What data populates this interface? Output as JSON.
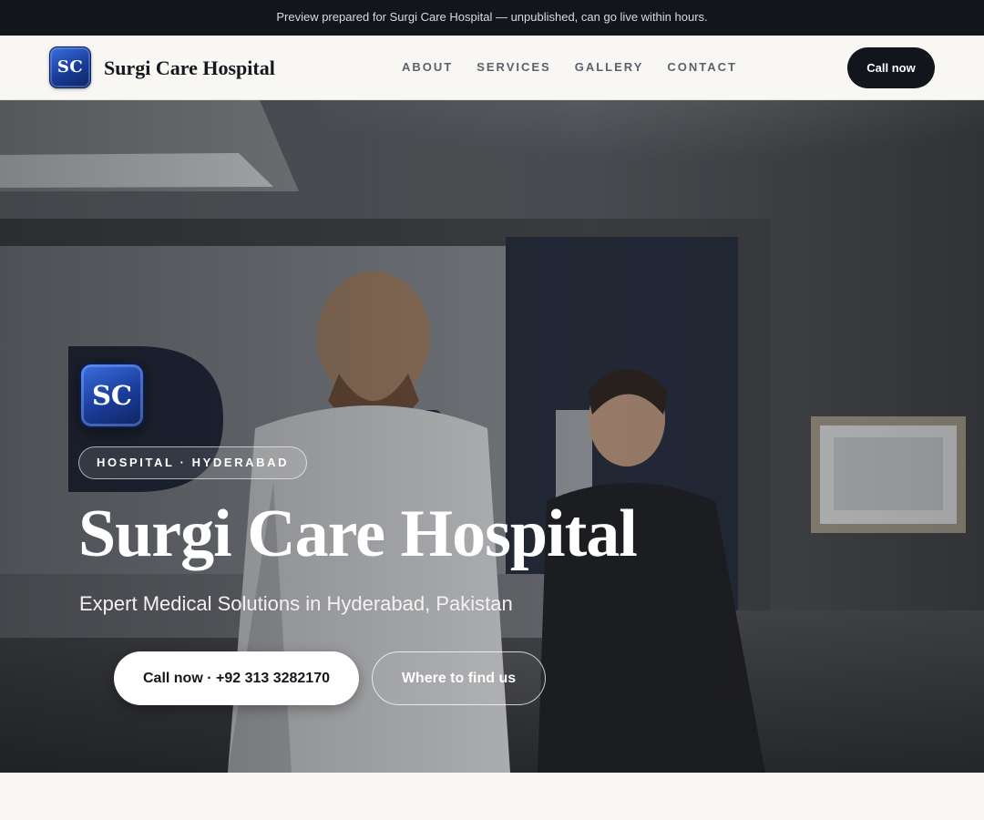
{
  "preview_banner": {
    "text": "Preview prepared for Surgi Care Hospital — unpublished, can go live within hours."
  },
  "header": {
    "logo_initials": "SC",
    "brand_name": "Surgi Care Hospital",
    "nav": [
      {
        "label": "ABOUT"
      },
      {
        "label": "SERVICES"
      },
      {
        "label": "GALLERY"
      },
      {
        "label": "CONTACT"
      }
    ],
    "call_button": "Call now"
  },
  "hero": {
    "logo_initials": "SC",
    "badge": "HOSPITAL · HYDERABAD",
    "title": "Surgi Care Hospital",
    "subtitle": "Expert Medical Solutions in Hyderabad, Pakistan",
    "primary_button": "Call now · +92 313 3282170",
    "secondary_button": "Where to find us"
  },
  "colors": {
    "banner_bg": "#12151b",
    "page_bg": "#f8f7f4",
    "brand_blue": "#1a3c98",
    "dark_button": "#12151b",
    "nav_text": "#5c616c"
  }
}
